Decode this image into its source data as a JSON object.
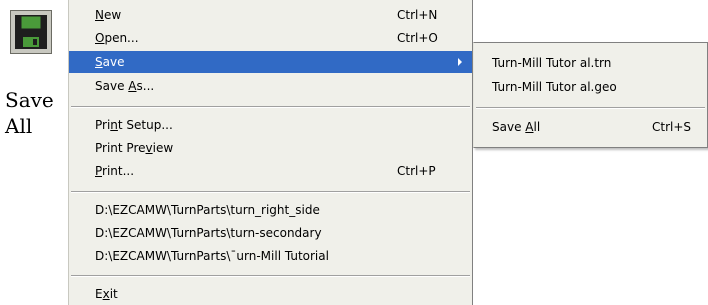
{
  "toolbar": {
    "icon": "floppy-disk-icon",
    "caption_line1": "Save",
    "caption_line2": "All"
  },
  "menu": {
    "items": [
      {
        "pre": "",
        "ul": "N",
        "post": "ew",
        "shortcut": "Ctrl+N"
      },
      {
        "pre": "",
        "ul": "O",
        "post": "pen...",
        "shortcut": "Ctrl+O"
      },
      {
        "pre": "",
        "ul": "S",
        "post": "ave",
        "shortcut": ""
      },
      {
        "pre": "Save ",
        "ul": "A",
        "post": "s...",
        "shortcut": ""
      },
      {
        "pre": "Pri",
        "ul": "n",
        "post": "t Setup...",
        "shortcut": ""
      },
      {
        "pre": "Print Pre",
        "ul": "v",
        "post": "iew",
        "shortcut": ""
      },
      {
        "pre": "",
        "ul": "P",
        "post": "rint...",
        "shortcut": "Ctrl+P"
      },
      {
        "pre": "D:\\EZCAMW\\TurnParts\\turn_right_side",
        "ul": "",
        "post": "",
        "shortcut": ""
      },
      {
        "pre": "D:\\EZCAMW\\TurnParts\\turn-secondary",
        "ul": "",
        "post": "",
        "shortcut": ""
      },
      {
        "pre": "D:\\EZCAMW\\TurnParts\\¯urn-Mill Tutorial",
        "ul": "",
        "post": "",
        "shortcut": ""
      },
      {
        "pre": "E",
        "ul": "x",
        "post": "it",
        "shortcut": ""
      }
    ]
  },
  "submenu": {
    "items": [
      {
        "pre": "Turn-Mill Tutor al.trn",
        "ul": "",
        "post": "",
        "shortcut": ""
      },
      {
        "pre": "Turn-Mill Tutor al.geo",
        "ul": "",
        "post": "",
        "shortcut": ""
      },
      {
        "pre": "Save ",
        "ul": "A",
        "post": "ll",
        "shortcut": "Ctrl+S"
      }
    ]
  },
  "colors": {
    "highlight": "#316ac5",
    "menu_bg": "#f0f0ea"
  }
}
